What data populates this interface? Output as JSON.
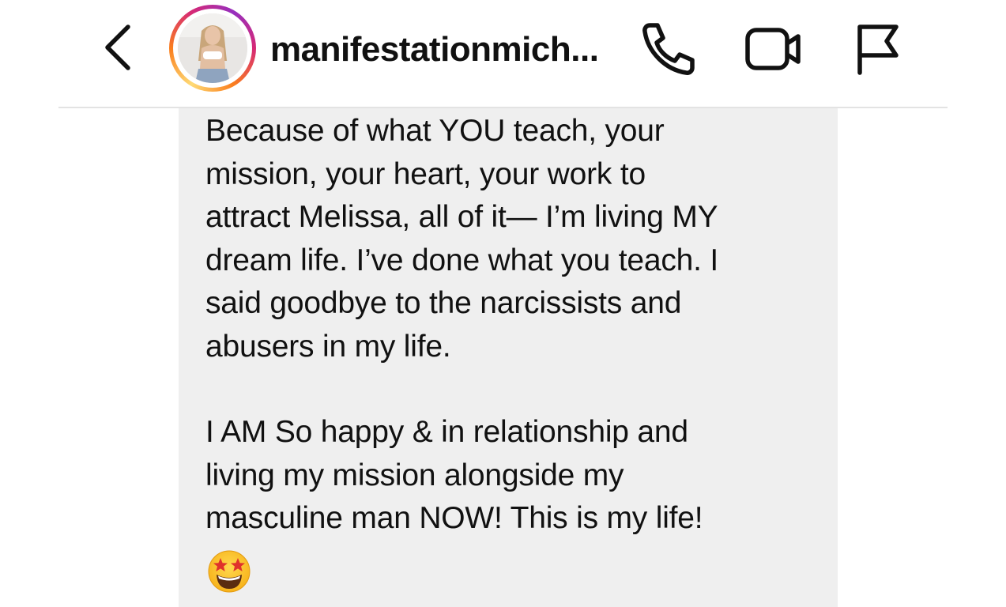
{
  "header": {
    "username": "manifestationmich...",
    "icons": {
      "back": "chevron-left-icon",
      "call": "phone-icon",
      "video": "video-camera-icon",
      "report": "flag-icon"
    },
    "avatar_ring_colors": [
      "#feda75",
      "#fa7e1e",
      "#d62976",
      "#962fbf"
    ]
  },
  "message": {
    "paragraph_1": "Because of what YOU teach, your\nmission, your heart, your work to\nattract Melissa, all of it— I’m living MY\ndream life. I’ve done what you teach. I\nsaid goodbye to the narcissists and\nabusers in my life.",
    "paragraph_2": "I AM So happy & in relationship and\nliving my mission alongside my\nmasculine man NOW! This is my life!",
    "emoji": "star-struck-emoji",
    "bubble_color": "#efefef"
  }
}
